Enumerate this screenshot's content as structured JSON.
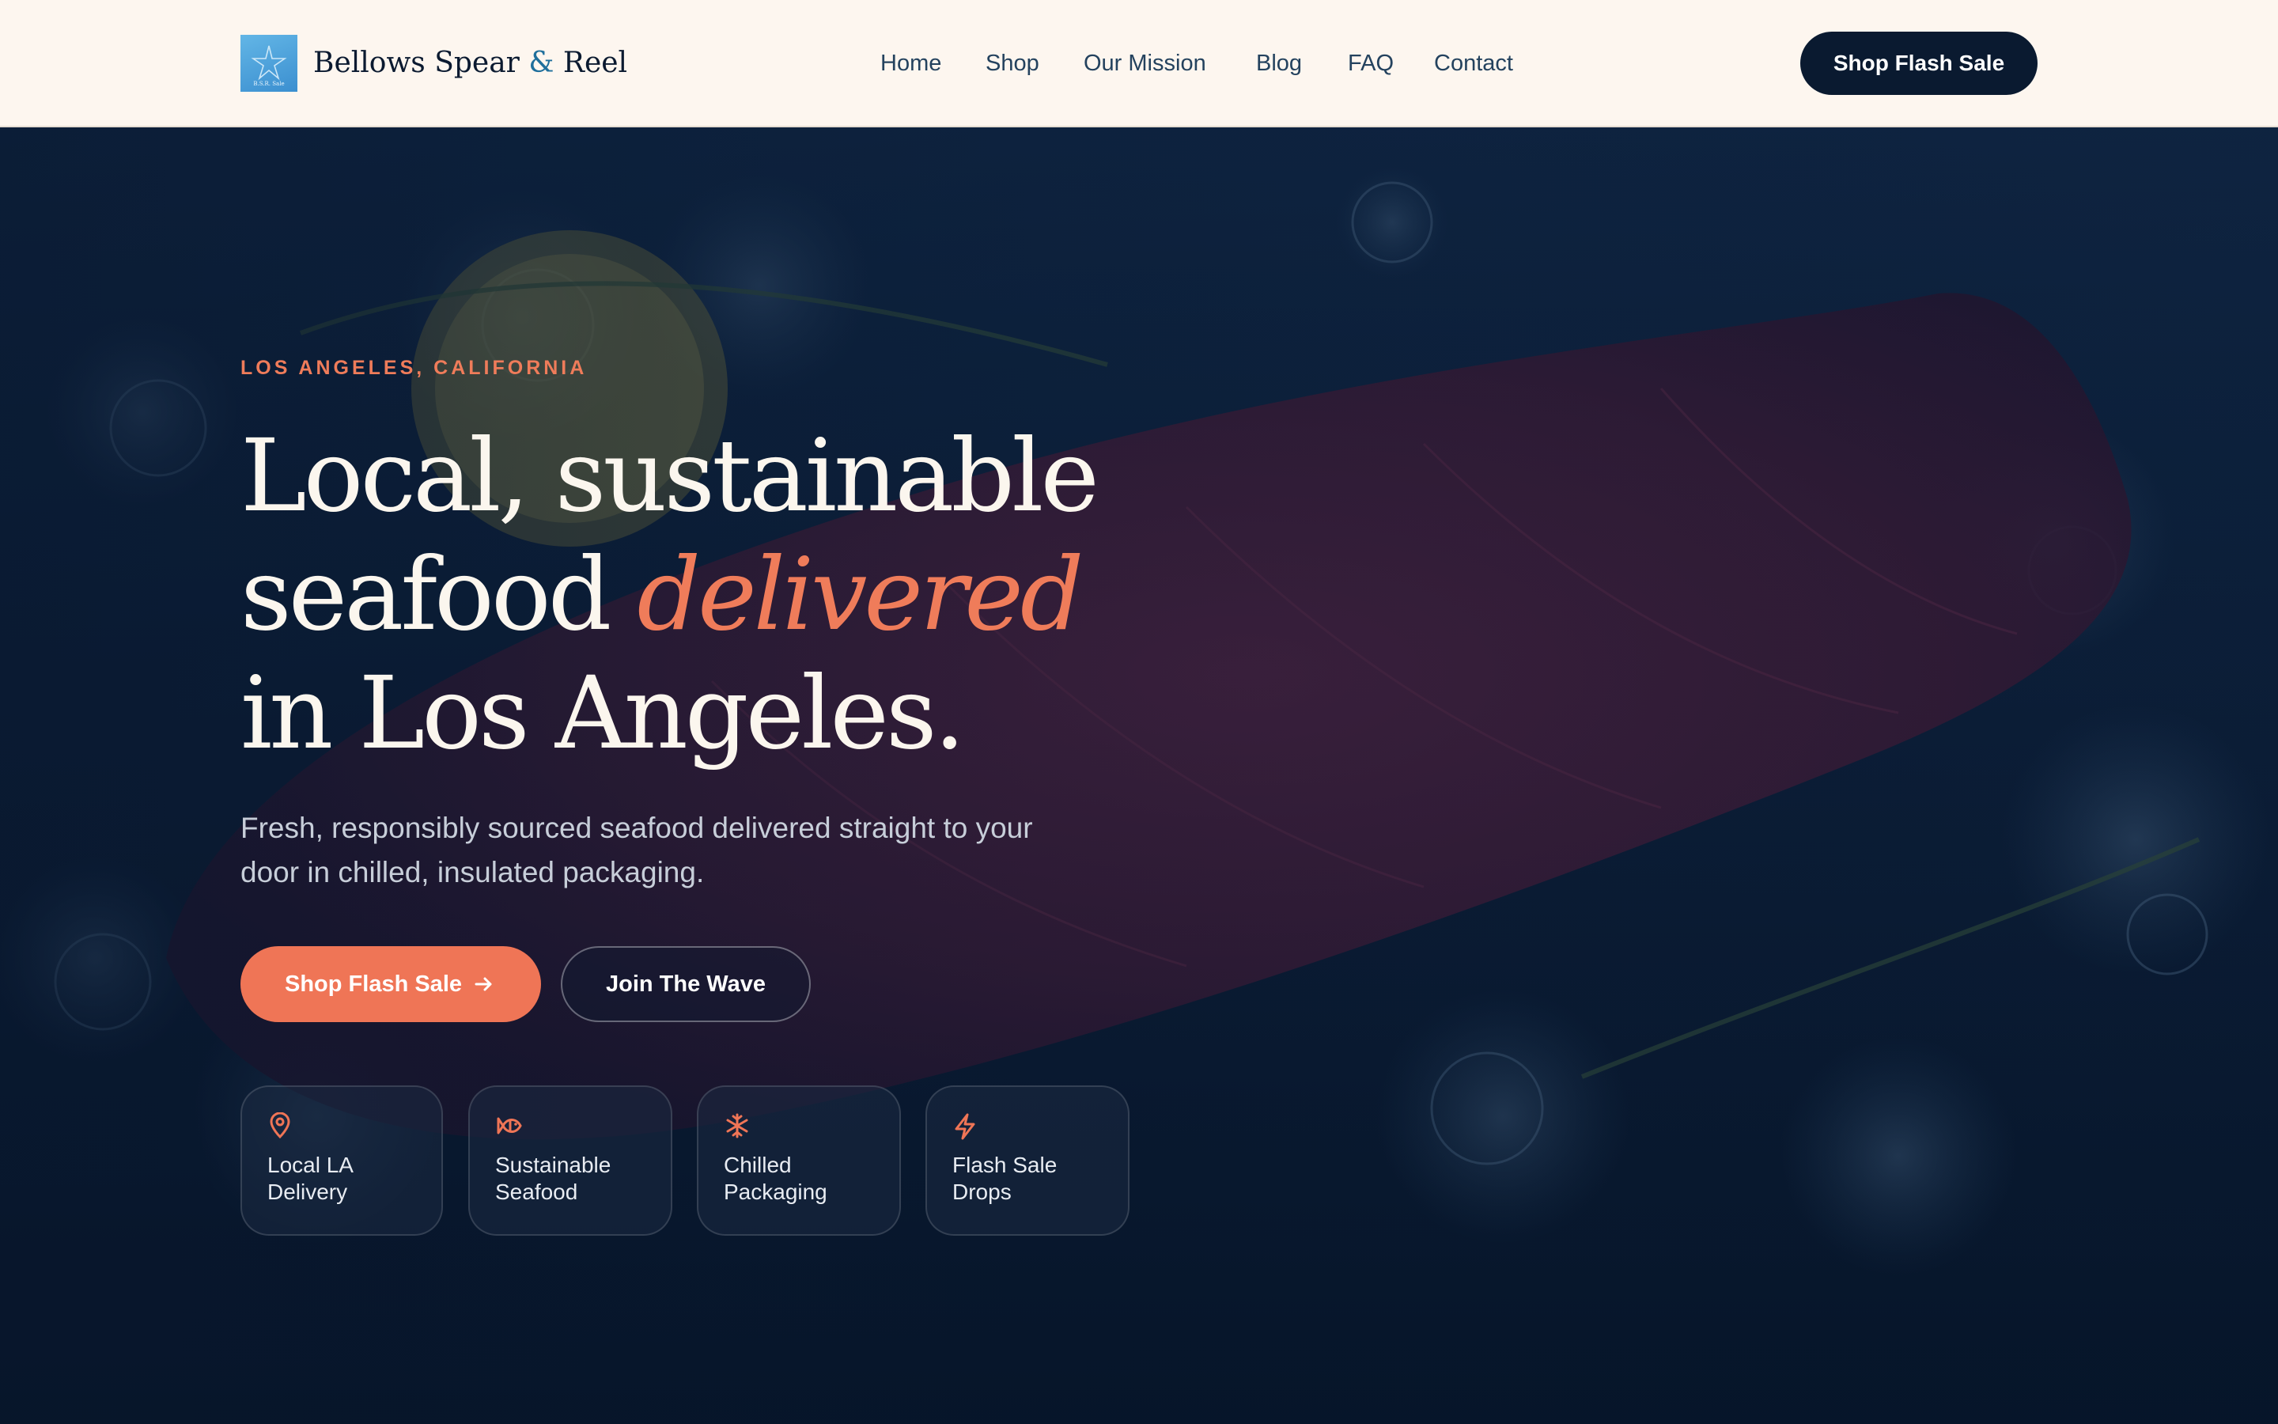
{
  "header": {
    "brand_name_part1": "Bellows Spear",
    "brand_amp": "&",
    "brand_name_part2": "Reel",
    "logo_badge_text": "B.S.R. Sale",
    "nav": [
      "Home",
      "Shop",
      "Our Mission",
      "Blog",
      "FAQ",
      "Contact"
    ],
    "cta_label": "Shop Flash Sale"
  },
  "hero": {
    "eyebrow": "LOS ANGELES, CALIFORNIA",
    "headline_line1": "Local, sustainable",
    "headline_line2_plain": "seafood",
    "headline_line2_accent": "delivered",
    "headline_line3": "in Los Angeles.",
    "subtitle_line1": "Fresh, responsibly sourced seafood delivered straight to your",
    "subtitle_line2": "door in chilled, insulated packaging.",
    "primary_button": "Shop Flash Sale",
    "secondary_button": "Join The Wave",
    "features": [
      {
        "icon": "map-pin-icon",
        "line1": "Local LA",
        "line2": "Delivery"
      },
      {
        "icon": "fish-icon",
        "line1": "Sustainable",
        "line2": "Seafood"
      },
      {
        "icon": "snowflake-icon",
        "line1": "Chilled",
        "line2": "Packaging"
      },
      {
        "icon": "lightning-icon",
        "line1": "Flash Sale",
        "line2": "Drops"
      }
    ]
  },
  "colors": {
    "accent": "#ef7556",
    "navy": "#0a1a30",
    "header_bg": "#fdf6ef"
  }
}
